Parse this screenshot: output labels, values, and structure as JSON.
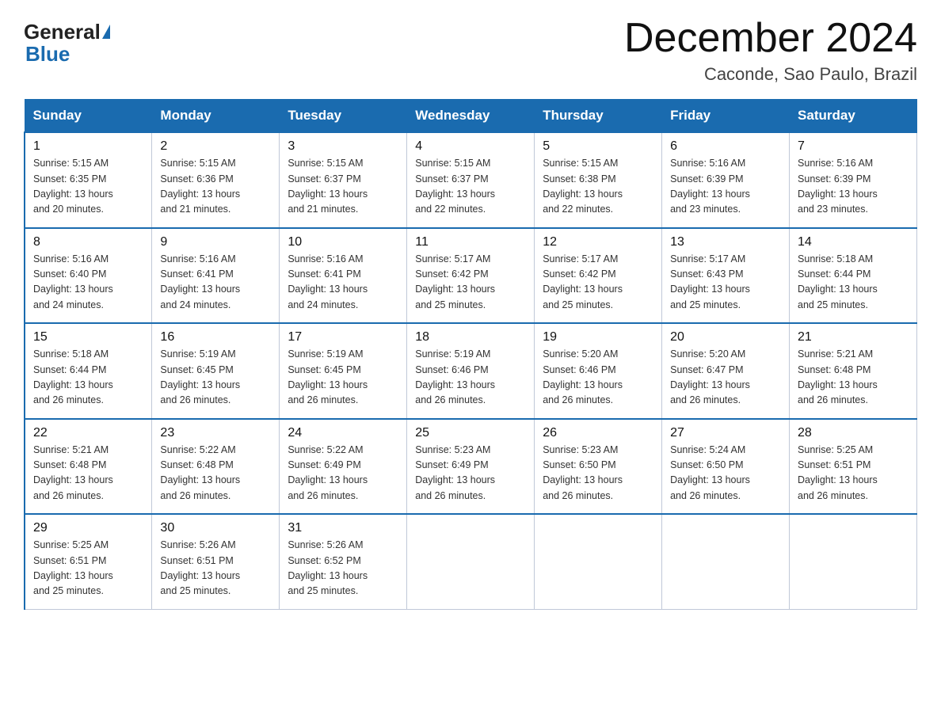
{
  "logo": {
    "general": "General",
    "blue": "Blue"
  },
  "header": {
    "title": "December 2024",
    "location": "Caconde, Sao Paulo, Brazil"
  },
  "days_of_week": [
    "Sunday",
    "Monday",
    "Tuesday",
    "Wednesday",
    "Thursday",
    "Friday",
    "Saturday"
  ],
  "weeks": [
    [
      {
        "day": "1",
        "sunrise": "5:15 AM",
        "sunset": "6:35 PM",
        "daylight": "13 hours and 20 minutes."
      },
      {
        "day": "2",
        "sunrise": "5:15 AM",
        "sunset": "6:36 PM",
        "daylight": "13 hours and 21 minutes."
      },
      {
        "day": "3",
        "sunrise": "5:15 AM",
        "sunset": "6:37 PM",
        "daylight": "13 hours and 21 minutes."
      },
      {
        "day": "4",
        "sunrise": "5:15 AM",
        "sunset": "6:37 PM",
        "daylight": "13 hours and 22 minutes."
      },
      {
        "day": "5",
        "sunrise": "5:15 AM",
        "sunset": "6:38 PM",
        "daylight": "13 hours and 22 minutes."
      },
      {
        "day": "6",
        "sunrise": "5:16 AM",
        "sunset": "6:39 PM",
        "daylight": "13 hours and 23 minutes."
      },
      {
        "day": "7",
        "sunrise": "5:16 AM",
        "sunset": "6:39 PM",
        "daylight": "13 hours and 23 minutes."
      }
    ],
    [
      {
        "day": "8",
        "sunrise": "5:16 AM",
        "sunset": "6:40 PM",
        "daylight": "13 hours and 24 minutes."
      },
      {
        "day": "9",
        "sunrise": "5:16 AM",
        "sunset": "6:41 PM",
        "daylight": "13 hours and 24 minutes."
      },
      {
        "day": "10",
        "sunrise": "5:16 AM",
        "sunset": "6:41 PM",
        "daylight": "13 hours and 24 minutes."
      },
      {
        "day": "11",
        "sunrise": "5:17 AM",
        "sunset": "6:42 PM",
        "daylight": "13 hours and 25 minutes."
      },
      {
        "day": "12",
        "sunrise": "5:17 AM",
        "sunset": "6:42 PM",
        "daylight": "13 hours and 25 minutes."
      },
      {
        "day": "13",
        "sunrise": "5:17 AM",
        "sunset": "6:43 PM",
        "daylight": "13 hours and 25 minutes."
      },
      {
        "day": "14",
        "sunrise": "5:18 AM",
        "sunset": "6:44 PM",
        "daylight": "13 hours and 25 minutes."
      }
    ],
    [
      {
        "day": "15",
        "sunrise": "5:18 AM",
        "sunset": "6:44 PM",
        "daylight": "13 hours and 26 minutes."
      },
      {
        "day": "16",
        "sunrise": "5:19 AM",
        "sunset": "6:45 PM",
        "daylight": "13 hours and 26 minutes."
      },
      {
        "day": "17",
        "sunrise": "5:19 AM",
        "sunset": "6:45 PM",
        "daylight": "13 hours and 26 minutes."
      },
      {
        "day": "18",
        "sunrise": "5:19 AM",
        "sunset": "6:46 PM",
        "daylight": "13 hours and 26 minutes."
      },
      {
        "day": "19",
        "sunrise": "5:20 AM",
        "sunset": "6:46 PM",
        "daylight": "13 hours and 26 minutes."
      },
      {
        "day": "20",
        "sunrise": "5:20 AM",
        "sunset": "6:47 PM",
        "daylight": "13 hours and 26 minutes."
      },
      {
        "day": "21",
        "sunrise": "5:21 AM",
        "sunset": "6:48 PM",
        "daylight": "13 hours and 26 minutes."
      }
    ],
    [
      {
        "day": "22",
        "sunrise": "5:21 AM",
        "sunset": "6:48 PM",
        "daylight": "13 hours and 26 minutes."
      },
      {
        "day": "23",
        "sunrise": "5:22 AM",
        "sunset": "6:48 PM",
        "daylight": "13 hours and 26 minutes."
      },
      {
        "day": "24",
        "sunrise": "5:22 AM",
        "sunset": "6:49 PM",
        "daylight": "13 hours and 26 minutes."
      },
      {
        "day": "25",
        "sunrise": "5:23 AM",
        "sunset": "6:49 PM",
        "daylight": "13 hours and 26 minutes."
      },
      {
        "day": "26",
        "sunrise": "5:23 AM",
        "sunset": "6:50 PM",
        "daylight": "13 hours and 26 minutes."
      },
      {
        "day": "27",
        "sunrise": "5:24 AM",
        "sunset": "6:50 PM",
        "daylight": "13 hours and 26 minutes."
      },
      {
        "day": "28",
        "sunrise": "5:25 AM",
        "sunset": "6:51 PM",
        "daylight": "13 hours and 26 minutes."
      }
    ],
    [
      {
        "day": "29",
        "sunrise": "5:25 AM",
        "sunset": "6:51 PM",
        "daylight": "13 hours and 25 minutes."
      },
      {
        "day": "30",
        "sunrise": "5:26 AM",
        "sunset": "6:51 PM",
        "daylight": "13 hours and 25 minutes."
      },
      {
        "day": "31",
        "sunrise": "5:26 AM",
        "sunset": "6:52 PM",
        "daylight": "13 hours and 25 minutes."
      },
      null,
      null,
      null,
      null
    ]
  ],
  "labels": {
    "sunrise": "Sunrise:",
    "sunset": "Sunset:",
    "daylight": "Daylight:"
  }
}
